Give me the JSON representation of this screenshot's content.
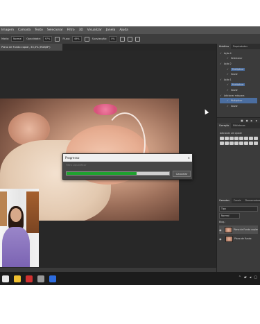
{
  "menubar": {
    "items": [
      "Imagem",
      "Camada",
      "Texto",
      "Selecionar",
      "Filtro",
      "3D",
      "Visualizar",
      "Janela",
      "Ajuda"
    ]
  },
  "optbar": {
    "mode_label": "Modo:",
    "mode_value": "Normal",
    "opacity_label": "Opacidade:",
    "opacity_value": "97%",
    "flow_label": "Fluxo:",
    "flow_value": "49%",
    "smoothing_label": "Suavização:",
    "smoothing_value": "0%"
  },
  "document": {
    "tab_title": "Plano de Fundo copiar, 33,3% (RGB/8*)"
  },
  "progress_dialog": {
    "title": "Progresso",
    "close_glyph": "×",
    "status": "Filtro Liquidificar",
    "progress": 0.68,
    "cancel_label": "Cancelar"
  },
  "history_panel": {
    "tabs": [
      "Histórico",
      "Propriedades"
    ],
    "rows": [
      {
        "label": "Ação 4",
        "level": 1
      },
      {
        "label": "Selecionar",
        "level": 2
      },
      {
        "label": "Ação 2",
        "level": 1
      },
      {
        "label": "Multiplicar",
        "level": 2
      },
      {
        "label": "Salvar",
        "level": 2
      },
      {
        "label": "Ação 1",
        "level": 1
      },
      {
        "label": "Multiplicar",
        "level": 2
      },
      {
        "label": "Salvar",
        "level": 2
      },
      {
        "label": "Adicionar máscara",
        "level": 1
      },
      {
        "label": "Multiplicar",
        "level": 2
      },
      {
        "label": "Salvar",
        "level": 2
      }
    ]
  },
  "adjustments_panel": {
    "tabs": [
      "Correção",
      "Bibliotecas"
    ],
    "prompt": "Adicionar um ajuste"
  },
  "layers_panel": {
    "tabs": [
      "Camadas",
      "Canais",
      "Demarcadores"
    ],
    "filter_label": "Tipo",
    "blend_mode": "Normal",
    "lock_label": "Bloq.:",
    "layers": [
      {
        "name": "Plano de Fundo copiar",
        "selected": true
      },
      {
        "name": "Plano de Fundo",
        "selected": false
      }
    ]
  },
  "taskbar": {
    "icons": [
      "chrome-icon",
      "folder-icon",
      "app-red-icon",
      "app-gray-icon",
      "photoshop-icon"
    ],
    "icon_colors": [
      "#e8e8e8",
      "#f0c030",
      "#d03030",
      "#999999",
      "#2d6cdf"
    ]
  }
}
